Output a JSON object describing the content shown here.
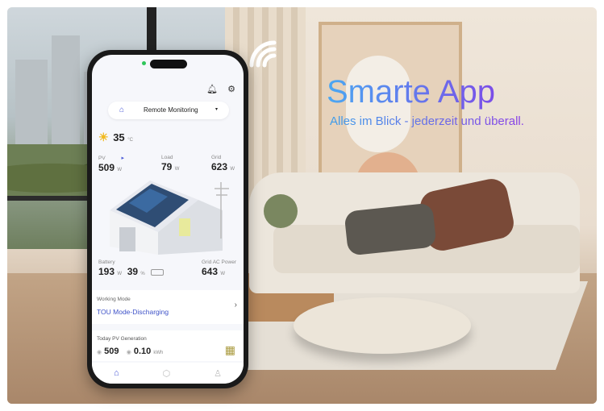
{
  "promo": {
    "headline": "Smarte App",
    "subline": "Alles im Blick - jederzeit und überall."
  },
  "app": {
    "header": {
      "bell_icon": "bell-icon",
      "settings_icon": "gear-icon"
    },
    "selector": {
      "label": "Remote Monitoring",
      "icon": "plant-icon",
      "caret": "▾"
    },
    "weather": {
      "temp": "35",
      "unit": "°C"
    },
    "stats": {
      "pv": {
        "label": "PV",
        "value": "509",
        "unit": "W"
      },
      "load": {
        "label": "Load",
        "value": "79",
        "unit": "W"
      },
      "grid": {
        "label": "Grid",
        "value": "623",
        "unit": "W"
      },
      "battery": {
        "label": "Battery",
        "value": "193",
        "unit": "W",
        "soc": "39",
        "soc_unit": "%"
      },
      "grid_ac": {
        "label": "Grid AC Power",
        "value": "643",
        "unit": "W"
      }
    },
    "working_mode": {
      "title": "Working Mode",
      "value": "TOU Mode-Discharging"
    },
    "generation": {
      "title": "Today PV Generation",
      "power": "509",
      "energy": "0.10",
      "energy_unit": "kWh"
    },
    "tabs": [
      {
        "name": "home",
        "icon": "home-icon",
        "active": true
      },
      {
        "name": "devices",
        "icon": "device-icon",
        "active": false
      },
      {
        "name": "profile",
        "icon": "user-icon",
        "active": false
      }
    ]
  },
  "colors": {
    "accent": "#4b5bd8",
    "headline_start": "#4aa8f2",
    "headline_end": "#7b4de8"
  }
}
